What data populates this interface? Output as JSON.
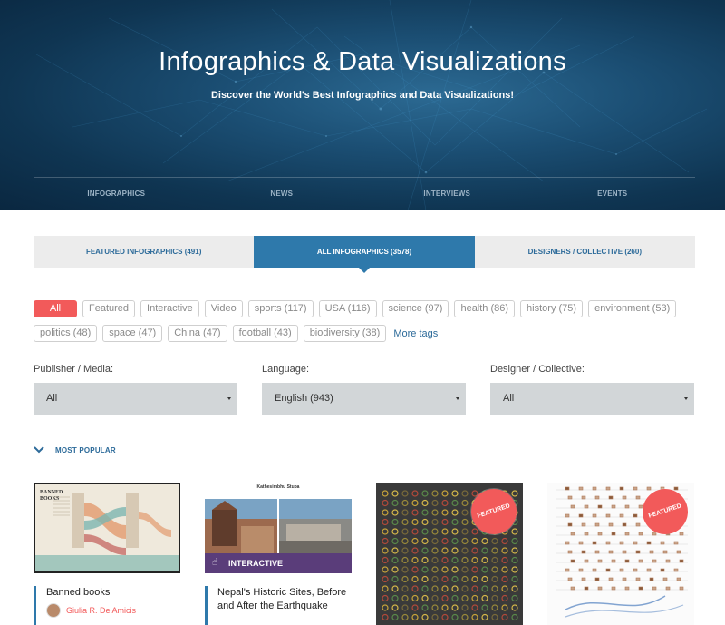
{
  "hero": {
    "title": "Infographics & Data Visualizations",
    "subtitle": "Discover the World's Best Infographics and Data Visualizations!",
    "nav": [
      "INFOGRAPHICS",
      "NEWS",
      "INTERVIEWS",
      "EVENTS"
    ]
  },
  "tabs": [
    {
      "label": "FEATURED INFOGRAPHICS (491)",
      "active": false
    },
    {
      "label": "ALL INFOGRAPHICS (3578)",
      "active": true
    },
    {
      "label": "DESIGNERS / COLLECTIVE (260)",
      "active": false
    }
  ],
  "tags": {
    "row1": [
      "All",
      "Featured",
      "Interactive",
      "Video",
      "sports (117)",
      "USA (116)",
      "science (97)",
      "health (86)",
      "history (75)",
      "environment (53)"
    ],
    "row2": [
      "politics (48)",
      "space (47)",
      "China (47)",
      "football (43)",
      "biodiversity (38)"
    ],
    "more": "More tags"
  },
  "filters": [
    {
      "label": "Publisher / Media:",
      "value": "All"
    },
    {
      "label": "Language:",
      "value": "English (943)"
    },
    {
      "label": "Designer / Collective:",
      "value": "All"
    }
  ],
  "section": {
    "label": "MOST POPULAR"
  },
  "cards": [
    {
      "title": "Banned books",
      "author": "Giulia R. De Amicis",
      "thumb_text": "BANNED BOOKS"
    },
    {
      "title": "Nepal's Historic Sites, Before and After the Earthquake",
      "thumb_heading": "Kathesimbhu Stupa",
      "badge": "INTERACTIVE"
    },
    {
      "badge": "FEATURED"
    },
    {
      "badge": "FEATURED"
    }
  ],
  "colors": {
    "accent": "#2e79ab",
    "pill_active": "#f25a5a",
    "select_bg": "#d2d6d8"
  }
}
